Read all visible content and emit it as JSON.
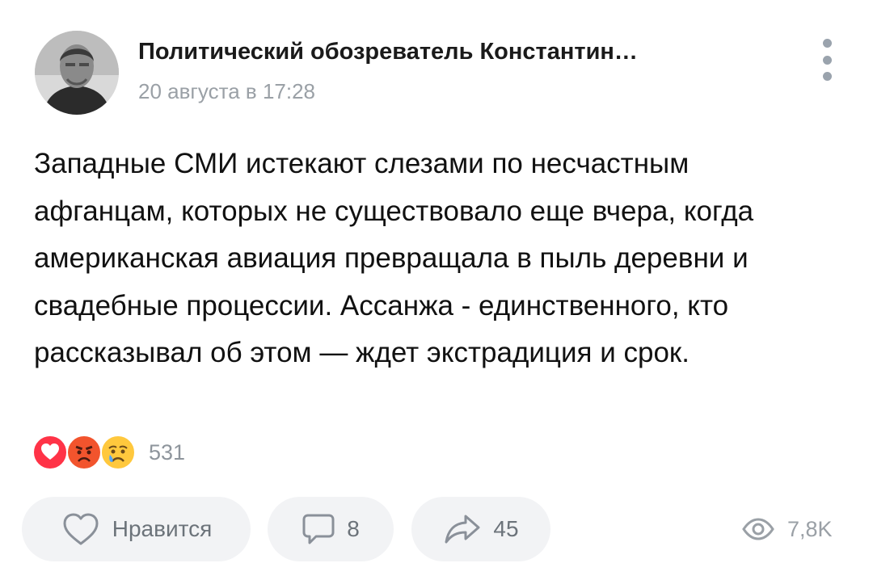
{
  "post": {
    "author": "Политический обозреватель Константин…",
    "date": "20 августа в 17:28",
    "text": "Западные СМИ истекают слезами по несчастным афганцам, которых не существовало еще вчера, когда американская авиация превращала в пыль деревни и свадебные процессии. Ассанжа - единственного, кто рассказывал об этом — ждет экстрадиция и срок."
  },
  "reactions": {
    "icons": [
      "heart-icon",
      "angry-face-icon",
      "crying-face-icon"
    ],
    "count": "531"
  },
  "actions": {
    "like_label": "Нравится",
    "comments_count": "8",
    "shares_count": "45",
    "views_count": "7,8K"
  },
  "colors": {
    "button_bg": "#f2f3f5",
    "muted_text": "#9aa0a6",
    "heart": "#ff3347"
  }
}
